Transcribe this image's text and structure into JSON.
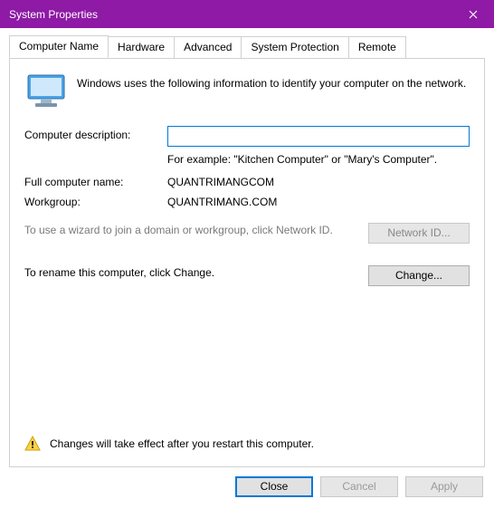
{
  "window": {
    "title": "System Properties"
  },
  "tabs": {
    "computer_name": "Computer Name",
    "hardware": "Hardware",
    "advanced": "Advanced",
    "system_protection": "System Protection",
    "remote": "Remote"
  },
  "panel": {
    "intro": "Windows uses the following information to identify your computer on the network.",
    "description_label": "Computer description:",
    "description_value": "",
    "description_example": "For example: \"Kitchen Computer\" or \"Mary's Computer\".",
    "full_name_label": "Full computer name:",
    "full_name_value": "QUANTRIMANGCOM",
    "workgroup_label": "Workgroup:",
    "workgroup_value": "QUANTRIMANG.COM",
    "wizard_text": "To use a wizard to join a domain or workgroup, click Network ID.",
    "network_id_btn": "Network ID...",
    "rename_text": "To rename this computer, click Change.",
    "change_btn": "Change...",
    "restart_notice": "Changes will take effect after you restart this computer."
  },
  "footer": {
    "close": "Close",
    "cancel": "Cancel",
    "apply": "Apply"
  }
}
